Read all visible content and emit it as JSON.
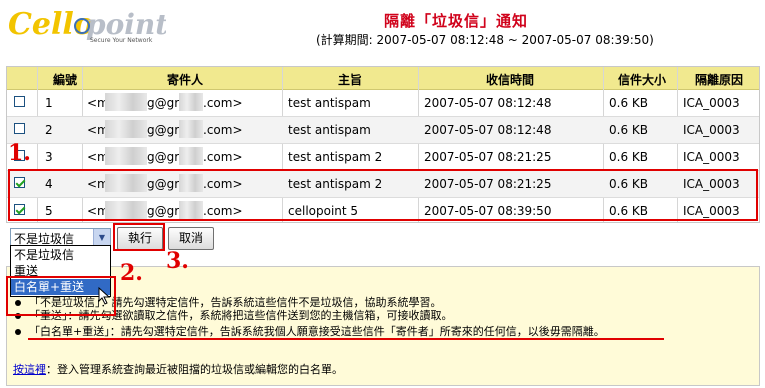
{
  "header": {
    "logo_text": "Cellopoint",
    "logo_tagline": "Secure Your Network",
    "title": "隔離「垃圾信」通知",
    "period": "(計算期間: 2007-05-07 08:12:48 ~ 2007-05-07 08:39:50)"
  },
  "table": {
    "columns": [
      "編號",
      "寄件人",
      "主旨",
      "收信時間",
      "信件大小",
      "隔離原因"
    ],
    "rows": [
      {
        "checked": false,
        "no": "1",
        "sender_prefix": "<m",
        "sender_mid": "g@gr",
        "sender_suffix": ".com>",
        "subject": "test antispam",
        "time": "2007-05-07 08:12:48",
        "size": "0.6 KB",
        "reason": "ICA_0003"
      },
      {
        "checked": false,
        "no": "2",
        "sender_prefix": "<m",
        "sender_mid": "g@gr",
        "sender_suffix": ".com>",
        "subject": "test antispam",
        "time": "2007-05-07 08:12:48",
        "size": "0.6 KB",
        "reason": "ICA_0003"
      },
      {
        "checked": false,
        "no": "3",
        "sender_prefix": "<m",
        "sender_mid": "g@gr",
        "sender_suffix": ".com>",
        "subject": "test antispam 2",
        "time": "2007-05-07 08:21:25",
        "size": "0.6 KB",
        "reason": "ICA_0003"
      },
      {
        "checked": true,
        "no": "4",
        "sender_prefix": "<m",
        "sender_mid": "g@gr",
        "sender_suffix": ".com>",
        "subject": "test antispam 2",
        "time": "2007-05-07 08:21:25",
        "size": "0.6 KB",
        "reason": "ICA_0003"
      },
      {
        "checked": true,
        "no": "5",
        "sender_prefix": "<m",
        "sender_mid": "g@gr",
        "sender_suffix": ".com>",
        "subject": "cellopoint 5",
        "time": "2007-05-07 08:39:50",
        "size": "0.6 KB",
        "reason": "ICA_0003"
      }
    ]
  },
  "controls": {
    "select_value": "不是垃圾信",
    "select_options": [
      "不是垃圾信",
      "重送",
      "白名單+重送"
    ],
    "run_label": "執行",
    "cancel_label": "取消"
  },
  "notes": [
    "「不是垃圾信」：請先勾選特定信件，告訴系統這些信件不是垃圾信，協助系統學習。",
    "「重送」：請先勾選欲讀取之信件，系統將把這些信件送到您的主機信箱，可接收讀取。",
    "「白名單+重送」：請先勾選特定信件，告訴系統我個人願意接受這些信件「寄件者」所寄來的任何信，以後毋需隔離。"
  ],
  "footer": {
    "link_text": "按這裡",
    "rest_text": "：登入管理系統查詢最近被阻擋的垃圾信或編輯您的白名單。"
  },
  "annotations": {
    "step1": "1.",
    "step2": "2.",
    "step3": "3."
  },
  "colors": {
    "accent_red": "#e00000",
    "header_yellow": "#f1e98f",
    "title_red": "#d0021b"
  }
}
